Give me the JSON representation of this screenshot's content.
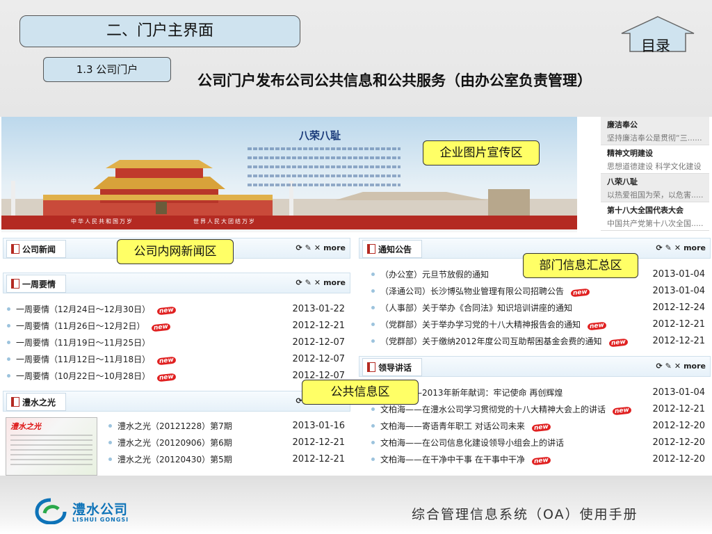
{
  "slide": {
    "section_title": "二、门户主界面",
    "sub_section": "1.3  公司门户",
    "headline": "公司门户发布公司公共信息和公共服务（由办公室负责管理）",
    "home_label": "目录"
  },
  "banner": {
    "title": "八荣八耻",
    "strip_left": "中华人民共和国万岁",
    "strip_right": "世界人民大团结万岁"
  },
  "side_list": [
    {
      "title": "廉洁奉公",
      "desc": "坚持廉洁奉公是贯彻“三......"
    },
    {
      "title": "精神文明建设",
      "desc": "思想道德建设 科学文化建设"
    },
    {
      "title": "八荣八耻",
      "desc": "以热爱祖国为荣，以危害......"
    },
    {
      "title": "第十八大全国代表大会",
      "desc": "中国共产党第十八次全国......"
    }
  ],
  "panel_tools": {
    "refresh": "⟳",
    "edit": "✎",
    "close": "✕",
    "more": "more"
  },
  "new_badge": "new",
  "panels": {
    "company_news": {
      "name": "公司新闻"
    },
    "weekly": {
      "name": "一周要情",
      "items": [
        {
          "text": "一周要情（12月24日～12月30日）",
          "date": "2013-01-22",
          "new": true
        },
        {
          "text": "一周要情（11月26日～12月2日）",
          "date": "2012-12-21",
          "new": true
        },
        {
          "text": "一周要情（11月19日～11月25日）",
          "date": "2012-12-07",
          "new": false
        },
        {
          "text": "一周要情（11月12日～11月18日）",
          "date": "2012-12-07",
          "new": true
        },
        {
          "text": "一周要情（10月22日～10月28日）",
          "date": "2012-12-07",
          "new": true
        }
      ]
    },
    "lishui_light": {
      "name": "澧水之光",
      "thumb_title": "澧水之光",
      "items": [
        {
          "text": "澧水之光（20121228）第7期",
          "date": "2013-01-16",
          "new": false
        },
        {
          "text": "澧水之光（20120906）第6期",
          "date": "2012-12-21",
          "new": false
        },
        {
          "text": "澧水之光（20120430）第5期",
          "date": "2012-12-21",
          "new": false
        }
      ]
    },
    "notices": {
      "name": "通知公告",
      "items": [
        {
          "text": "（办公室）元旦节放假的通知",
          "date": "2013-01-04",
          "new": false
        },
        {
          "text": "（泽通公司）长沙博弘物业管理有限公司招聘公告",
          "date": "2013-01-04",
          "new": true
        },
        {
          "text": "（人事部）关于举办《合同法》知识培训讲座的通知",
          "date": "2012-12-24",
          "new": false
        },
        {
          "text": "（党群部）关于举办学习党的十八大精神报告会的通知",
          "date": "2012-12-21",
          "new": true
        },
        {
          "text": "（党群部）关于缴纳2012年度公司互助帮困基金会费的通知",
          "date": "2012-12-21",
          "new": true
        }
      ]
    },
    "leader_speech": {
      "name": "领导讲话",
      "items": [
        {
          "text": "文柏海——2013年新年献词：牢记使命  再创辉煌",
          "date": "2013-01-04",
          "new": false
        },
        {
          "text": "文柏海——在澧水公司学习贯彻党的十八大精神大会上的讲话",
          "date": "2012-12-21",
          "new": true
        },
        {
          "text": "文柏海——寄语青年职工  对话公司未来",
          "date": "2012-12-20",
          "new": true
        },
        {
          "text": "文柏海——在公司信息化建设领导小组会上的讲话",
          "date": "2012-12-20",
          "new": false
        },
        {
          "text": "文柏海——在干净中干事  在干事中干净",
          "date": "2012-12-20",
          "new": true
        }
      ]
    }
  },
  "callouts": {
    "banner": "企业图片宣传区",
    "news": "公司内网新闻区",
    "dept": "部门信息汇总区",
    "public": "公共信息区"
  },
  "footer": {
    "logo_cn": "澧水公司",
    "logo_en": "LISHUI GONGSI",
    "manual_title": "综合管理信息系统（OA）使用手册"
  }
}
